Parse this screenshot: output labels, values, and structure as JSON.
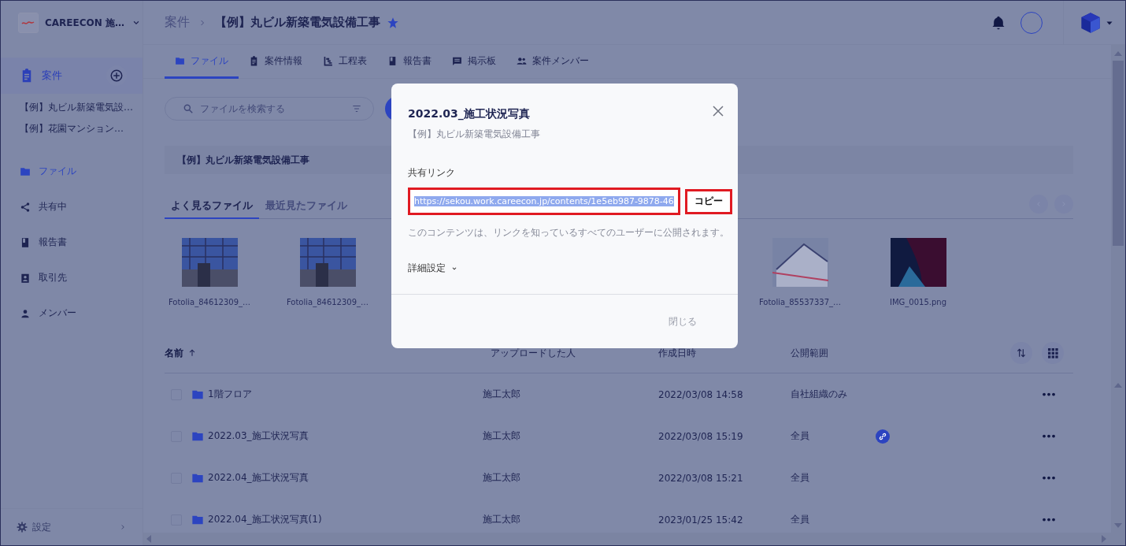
{
  "sidebar": {
    "brand": "CAREECON 施…",
    "nav": [
      {
        "label": "案件",
        "selected": true
      }
    ],
    "projects": [
      "【例】丸ビル新築電気設…",
      "【例】花園マンション…"
    ],
    "items": [
      {
        "label": "ファイル",
        "kind": "folder",
        "selected": true
      },
      {
        "label": "共有中",
        "kind": "share",
        "selected": false
      },
      {
        "label": "報告書",
        "kind": "book",
        "selected": false
      },
      {
        "label": "取引先",
        "kind": "badge",
        "selected": false
      },
      {
        "label": "メンバー",
        "kind": "person",
        "selected": false
      }
    ],
    "settings": "設定"
  },
  "header": {
    "breadcrumb": "案件",
    "title": "【例】丸ビル新築電気設備工事",
    "starred": true
  },
  "tabs": [
    {
      "label": "ファイル",
      "kind": "folder",
      "selected": true
    },
    {
      "label": "案件情報",
      "kind": "clipboard",
      "selected": false
    },
    {
      "label": "工程表",
      "kind": "gantt",
      "selected": false
    },
    {
      "label": "報告書",
      "kind": "book",
      "selected": false
    },
    {
      "label": "掲示板",
      "kind": "board",
      "selected": false
    },
    {
      "label": "案件メンバー",
      "kind": "people",
      "selected": false
    }
  ],
  "search": {
    "placeholder": "ファイルを検索する"
  },
  "project_banner": "【例】丸ビル新築電気設備工事",
  "file_tabs": [
    {
      "label": "よく見るファイル",
      "selected": true
    },
    {
      "label": "最近見たファイル",
      "selected": false
    }
  ],
  "thumbnails": [
    {
      "name": "Fotolia_84612309_…",
      "kind": "scaffold"
    },
    {
      "name": "Fotolia_84612309_…",
      "kind": "scaffold"
    },
    {
      "name": "Fotolia_85537337_…",
      "kind": "house"
    },
    {
      "name": "IMG_0015.png",
      "kind": "wallpaper"
    }
  ],
  "table": {
    "columns": [
      {
        "label": "名前",
        "sorted": true
      },
      {
        "label": "アップロードした人",
        "sorted": false
      },
      {
        "label": "作成日時",
        "sorted": false
      },
      {
        "label": "公開範囲",
        "sorted": false
      }
    ],
    "rows": [
      {
        "name": "1階フロア",
        "uploader": "施工太郎",
        "created": "2022/03/08 14:58",
        "visibility": "自社組織のみ",
        "checked": false,
        "link_shared": false
      },
      {
        "name": "2022.03_施工状況写真",
        "uploader": "施工太郎",
        "created": "2022/03/08 15:19",
        "visibility": "全員",
        "checked": false,
        "link_shared": true
      },
      {
        "name": "2022.04_施工状況写真",
        "uploader": "施工太郎",
        "created": "2022/03/08 15:21",
        "visibility": "全員",
        "checked": false,
        "link_shared": false
      },
      {
        "name": "2022.04_施工状況写真(1)",
        "uploader": "施工太郎",
        "created": "2023/01/25 15:42",
        "visibility": "全員",
        "checked": false,
        "link_shared": false
      }
    ]
  },
  "dialog": {
    "title": "2022.03_施工状況写真",
    "subtitle": "【例】丸ビル新築電気設備工事",
    "link_label": "共有リンク",
    "url": "https://sekou.work.careecon.jp/contents/1e5eb987-9878-46",
    "url_selected": true,
    "url_marked": true,
    "copy_button": "コピー",
    "copy_marked": true,
    "note": "このコンテンツは、リンクを知っているすべてのユーザーに公開されます。",
    "details": "詳細設定",
    "details_expanded": false,
    "close_button": "閉じる",
    "close_disabled": true
  }
}
